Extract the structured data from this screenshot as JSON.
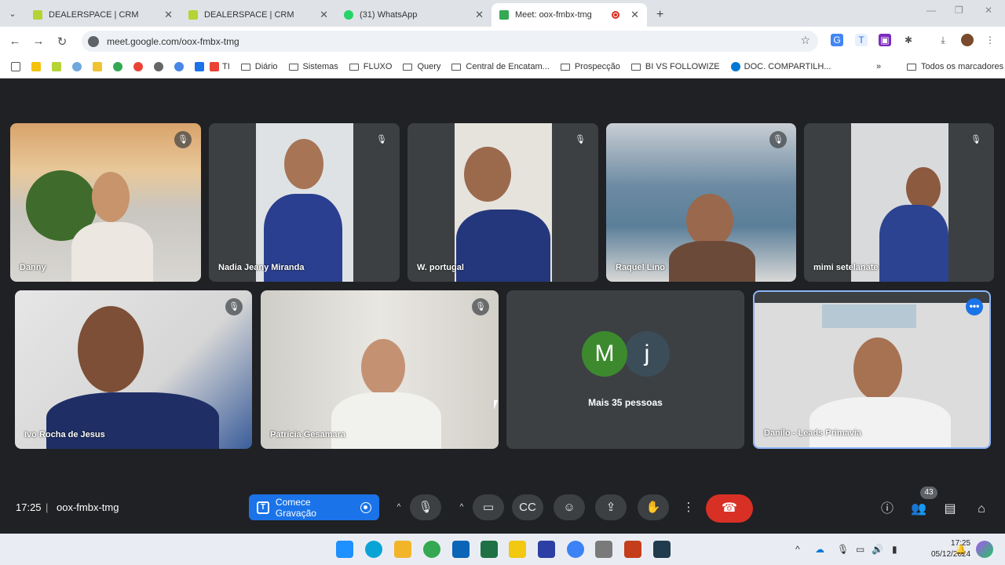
{
  "tabs": [
    {
      "title": "DEALERSPACE | CRM",
      "color": "#b5d334"
    },
    {
      "title": "DEALERSPACE | CRM",
      "color": "#b5d334"
    },
    {
      "title": "(31) WhatsApp",
      "color": "#25d366"
    },
    {
      "title": "Meet: oox-fmbx-tmg",
      "color": "#34a853",
      "active": true
    }
  ],
  "address": {
    "url": "meet.google.com/oox-fmbx-tmg"
  },
  "bookmarks": {
    "items": [
      "TI",
      "Diário",
      "Sistemas",
      "FLUXO",
      "Query",
      "Central de Encatam...",
      "Prospecção",
      "BI VS FOLLOWIZE",
      "DOC. COMPARTILH..."
    ],
    "all": "Todos os marcadores"
  },
  "participants": [
    {
      "name": "Danny"
    },
    {
      "name": "Nadia Jeany Miranda"
    },
    {
      "name": "W. portugal"
    },
    {
      "name": "Raquel Lino"
    },
    {
      "name": "mimi setelanate"
    },
    {
      "name": "Ivo Rocha de Jesus"
    },
    {
      "name": "Patricia Gesamara"
    },
    {
      "name": "Danilo - Leads Primavia"
    }
  ],
  "others": {
    "avatar1": "M",
    "avatar2": "j",
    "label": "Mais 35 pessoas",
    "color1": "#3d8a2e",
    "color2": "#3c4d5a"
  },
  "controls": {
    "time": "17:25",
    "separator": "|",
    "meeting_id": "oox-fmbx-tmg",
    "record_label": "Comece Gravação",
    "people_count": "43"
  },
  "system": {
    "time": "17:25",
    "date": "05/12/2024"
  }
}
